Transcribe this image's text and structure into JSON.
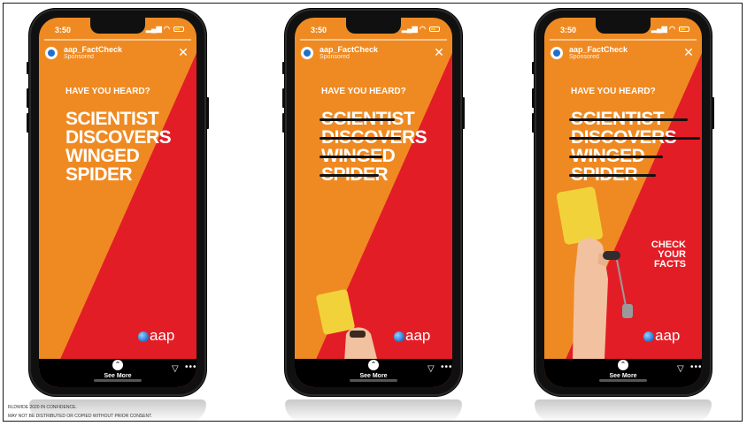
{
  "colors": {
    "orange": "#ef8a22",
    "red": "#e31d26",
    "phone_body": "#101010",
    "strike": "#111111",
    "logo_blue": "#1f6fd0"
  },
  "phones": [
    {
      "time": "3:50",
      "account_name": "aap_FactCheck",
      "sponsored_label": "Sponsored",
      "pre_headline": "HAVE YOU HEARD?",
      "headline_lines": [
        "SCIENTIST",
        "DISCOVERS",
        "WINGED",
        "SPIDER"
      ],
      "struck_fraction": 0,
      "check_lines": [],
      "logo_text": "aap",
      "see_more_label": "See More"
    },
    {
      "time": "3:50",
      "account_name": "aap_FactCheck",
      "sponsored_label": "Sponsored",
      "pre_headline": "HAVE YOU HEARD?",
      "headline_lines": [
        "SCIENTIST",
        "DISCOVERS",
        "WINGED",
        "SPIDER"
      ],
      "struck_fraction": 0.5,
      "check_lines": [],
      "logo_text": "aap",
      "see_more_label": "See More"
    },
    {
      "time": "3:50",
      "account_name": "aap_FactCheck",
      "sponsored_label": "Sponsored",
      "pre_headline": "HAVE YOU HEARD?",
      "headline_lines": [
        "SCIENTIST",
        "DISCOVERS",
        "WINGED",
        "SPIDER"
      ],
      "struck_fraction": 1,
      "check_lines": [
        "CHECK",
        "YOUR",
        "FACTS"
      ],
      "logo_text": "aap",
      "see_more_label": "See More"
    }
  ],
  "footer": {
    "line1": "RLDWIDE 2020 IN CONFIDENCE.",
    "line2": "MAY NOT BE DISTRIBUTED OR COPIED WITHOUT PRIOR CONSENT."
  }
}
